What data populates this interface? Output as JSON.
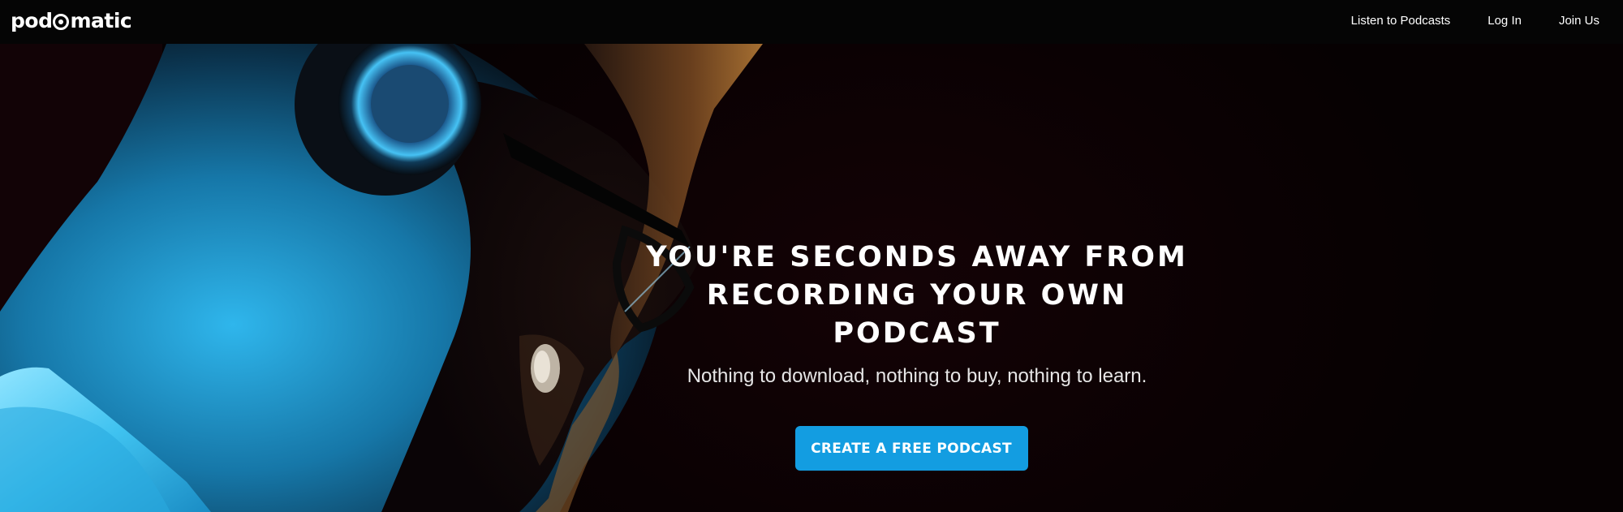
{
  "brand": {
    "logo_text_left": "pod",
    "logo_text_right": "matic"
  },
  "nav": {
    "links": [
      {
        "label": "Listen to Podcasts"
      },
      {
        "label": "Log In"
      },
      {
        "label": "Join Us"
      }
    ]
  },
  "hero": {
    "headline_line1": "YOU'RE SECONDS AWAY FROM",
    "headline_line2": "RECORDING YOUR OWN PODCAST",
    "subline": "Nothing to download, nothing to buy, nothing to learn.",
    "cta_label": "CREATE A FREE PODCAST"
  },
  "colors": {
    "nav_background": "#050505",
    "hero_background": "#0b0103",
    "cta_background": "#139de1",
    "photo_cyan": "#1aa8e6",
    "photo_amber": "#b8742f"
  },
  "icons": {
    "logo_mic": "microphone-o-icon"
  }
}
